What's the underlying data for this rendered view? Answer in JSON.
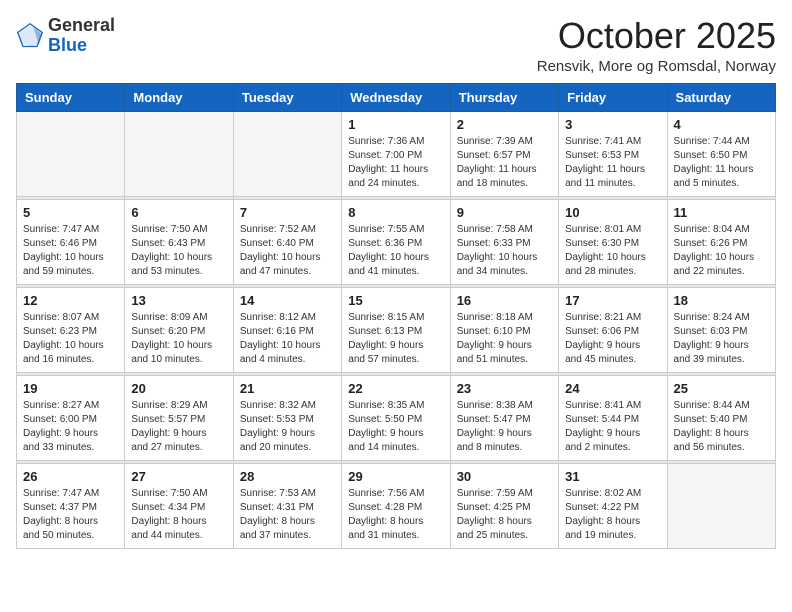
{
  "header": {
    "logo_general": "General",
    "logo_blue": "Blue",
    "month_title": "October 2025",
    "location": "Rensvik, More og Romsdal, Norway"
  },
  "weekdays": [
    "Sunday",
    "Monday",
    "Tuesday",
    "Wednesday",
    "Thursday",
    "Friday",
    "Saturday"
  ],
  "weeks": [
    [
      {
        "day": "",
        "info": ""
      },
      {
        "day": "",
        "info": ""
      },
      {
        "day": "",
        "info": ""
      },
      {
        "day": "1",
        "info": "Sunrise: 7:36 AM\nSunset: 7:00 PM\nDaylight: 11 hours\nand 24 minutes."
      },
      {
        "day": "2",
        "info": "Sunrise: 7:39 AM\nSunset: 6:57 PM\nDaylight: 11 hours\nand 18 minutes."
      },
      {
        "day": "3",
        "info": "Sunrise: 7:41 AM\nSunset: 6:53 PM\nDaylight: 11 hours\nand 11 minutes."
      },
      {
        "day": "4",
        "info": "Sunrise: 7:44 AM\nSunset: 6:50 PM\nDaylight: 11 hours\nand 5 minutes."
      }
    ],
    [
      {
        "day": "5",
        "info": "Sunrise: 7:47 AM\nSunset: 6:46 PM\nDaylight: 10 hours\nand 59 minutes."
      },
      {
        "day": "6",
        "info": "Sunrise: 7:50 AM\nSunset: 6:43 PM\nDaylight: 10 hours\nand 53 minutes."
      },
      {
        "day": "7",
        "info": "Sunrise: 7:52 AM\nSunset: 6:40 PM\nDaylight: 10 hours\nand 47 minutes."
      },
      {
        "day": "8",
        "info": "Sunrise: 7:55 AM\nSunset: 6:36 PM\nDaylight: 10 hours\nand 41 minutes."
      },
      {
        "day": "9",
        "info": "Sunrise: 7:58 AM\nSunset: 6:33 PM\nDaylight: 10 hours\nand 34 minutes."
      },
      {
        "day": "10",
        "info": "Sunrise: 8:01 AM\nSunset: 6:30 PM\nDaylight: 10 hours\nand 28 minutes."
      },
      {
        "day": "11",
        "info": "Sunrise: 8:04 AM\nSunset: 6:26 PM\nDaylight: 10 hours\nand 22 minutes."
      }
    ],
    [
      {
        "day": "12",
        "info": "Sunrise: 8:07 AM\nSunset: 6:23 PM\nDaylight: 10 hours\nand 16 minutes."
      },
      {
        "day": "13",
        "info": "Sunrise: 8:09 AM\nSunset: 6:20 PM\nDaylight: 10 hours\nand 10 minutes."
      },
      {
        "day": "14",
        "info": "Sunrise: 8:12 AM\nSunset: 6:16 PM\nDaylight: 10 hours\nand 4 minutes."
      },
      {
        "day": "15",
        "info": "Sunrise: 8:15 AM\nSunset: 6:13 PM\nDaylight: 9 hours\nand 57 minutes."
      },
      {
        "day": "16",
        "info": "Sunrise: 8:18 AM\nSunset: 6:10 PM\nDaylight: 9 hours\nand 51 minutes."
      },
      {
        "day": "17",
        "info": "Sunrise: 8:21 AM\nSunset: 6:06 PM\nDaylight: 9 hours\nand 45 minutes."
      },
      {
        "day": "18",
        "info": "Sunrise: 8:24 AM\nSunset: 6:03 PM\nDaylight: 9 hours\nand 39 minutes."
      }
    ],
    [
      {
        "day": "19",
        "info": "Sunrise: 8:27 AM\nSunset: 6:00 PM\nDaylight: 9 hours\nand 33 minutes."
      },
      {
        "day": "20",
        "info": "Sunrise: 8:29 AM\nSunset: 5:57 PM\nDaylight: 9 hours\nand 27 minutes."
      },
      {
        "day": "21",
        "info": "Sunrise: 8:32 AM\nSunset: 5:53 PM\nDaylight: 9 hours\nand 20 minutes."
      },
      {
        "day": "22",
        "info": "Sunrise: 8:35 AM\nSunset: 5:50 PM\nDaylight: 9 hours\nand 14 minutes."
      },
      {
        "day": "23",
        "info": "Sunrise: 8:38 AM\nSunset: 5:47 PM\nDaylight: 9 hours\nand 8 minutes."
      },
      {
        "day": "24",
        "info": "Sunrise: 8:41 AM\nSunset: 5:44 PM\nDaylight: 9 hours\nand 2 minutes."
      },
      {
        "day": "25",
        "info": "Sunrise: 8:44 AM\nSunset: 5:40 PM\nDaylight: 8 hours\nand 56 minutes."
      }
    ],
    [
      {
        "day": "26",
        "info": "Sunrise: 7:47 AM\nSunset: 4:37 PM\nDaylight: 8 hours\nand 50 minutes."
      },
      {
        "day": "27",
        "info": "Sunrise: 7:50 AM\nSunset: 4:34 PM\nDaylight: 8 hours\nand 44 minutes."
      },
      {
        "day": "28",
        "info": "Sunrise: 7:53 AM\nSunset: 4:31 PM\nDaylight: 8 hours\nand 37 minutes."
      },
      {
        "day": "29",
        "info": "Sunrise: 7:56 AM\nSunset: 4:28 PM\nDaylight: 8 hours\nand 31 minutes."
      },
      {
        "day": "30",
        "info": "Sunrise: 7:59 AM\nSunset: 4:25 PM\nDaylight: 8 hours\nand 25 minutes."
      },
      {
        "day": "31",
        "info": "Sunrise: 8:02 AM\nSunset: 4:22 PM\nDaylight: 8 hours\nand 19 minutes."
      },
      {
        "day": "",
        "info": ""
      }
    ]
  ]
}
